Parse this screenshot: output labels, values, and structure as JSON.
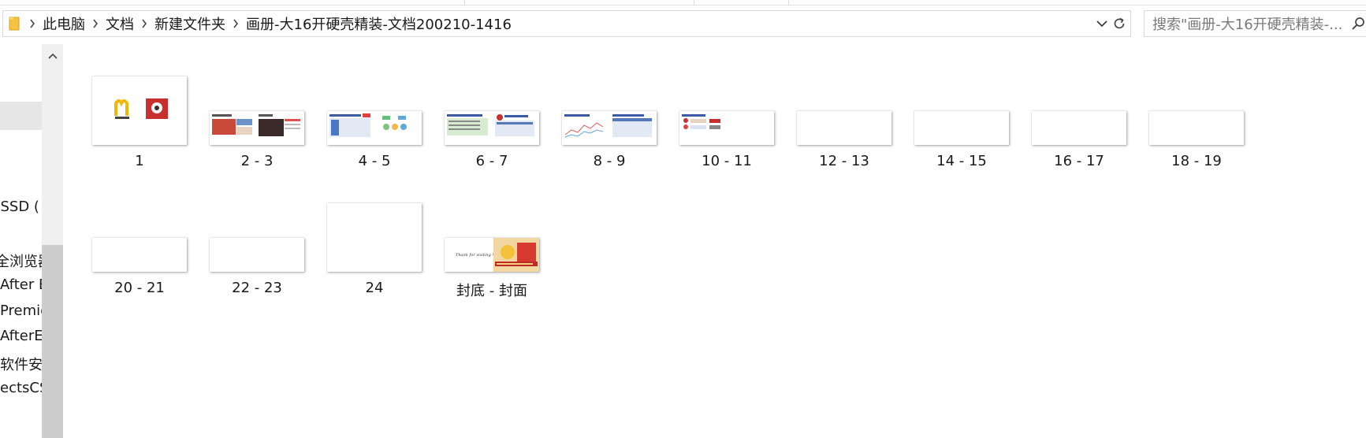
{
  "breadcrumb": {
    "items": [
      "此电脑",
      "文档",
      "新建文件夹",
      "画册-大16开硬壳精装-文档200210-1416"
    ]
  },
  "search": {
    "placeholder": "搜索\"画册-大16开硬壳精装-..."
  },
  "nav": {
    "items": [
      "-SSD (",
      "全浏览器",
      "After E",
      "Premie",
      "AfterEf",
      "软件安装",
      "ectsCS"
    ]
  },
  "files": [
    {
      "label": "1"
    },
    {
      "label": "2 - 3"
    },
    {
      "label": "4 - 5"
    },
    {
      "label": "6 - 7"
    },
    {
      "label": "8 - 9"
    },
    {
      "label": "10 - 11"
    },
    {
      "label": "12 - 13"
    },
    {
      "label": "14 - 15"
    },
    {
      "label": "16 - 17"
    },
    {
      "label": "18 - 19"
    },
    {
      "label": "20 - 21"
    },
    {
      "label": "22 - 23"
    },
    {
      "label": "24"
    },
    {
      "label": "封底 - 封面"
    }
  ],
  "thumb_text": {
    "back_cover_script": "Thank for visiting !"
  },
  "colors": {
    "folder": "#f5c242",
    "selection": "#e6e6e6",
    "scroll_thumb": "#cdcdcd",
    "scroll_track": "#f0f0f0"
  }
}
